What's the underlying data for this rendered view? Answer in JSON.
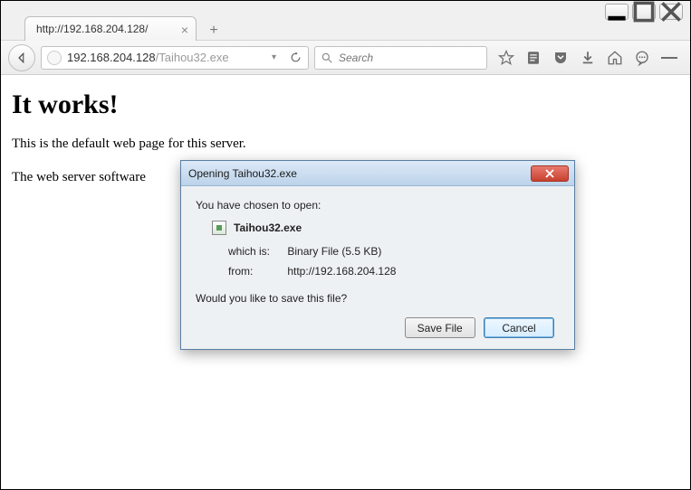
{
  "window_controls": {
    "min": "_",
    "max": "□",
    "close": "✕"
  },
  "tab": {
    "title": "http://192.168.204.128/"
  },
  "address_bar": {
    "host": "192.168.204.128",
    "path": "/Taihou32.exe"
  },
  "search": {
    "placeholder": "Search"
  },
  "page": {
    "heading": "It works!",
    "para1": "This is the default web page for this server.",
    "para2": "The web server software"
  },
  "dialog": {
    "title": "Opening Taihou32.exe",
    "you_have_chosen": "You have chosen to open:",
    "filename": "Taihou32.exe",
    "which_is_label": "which is:",
    "which_is_value": "Binary File (5.5 KB)",
    "from_label": "from:",
    "from_value": "http://192.168.204.128",
    "ask": "Would you like to save this file?",
    "save_btn": "Save File",
    "cancel_btn": "Cancel"
  }
}
